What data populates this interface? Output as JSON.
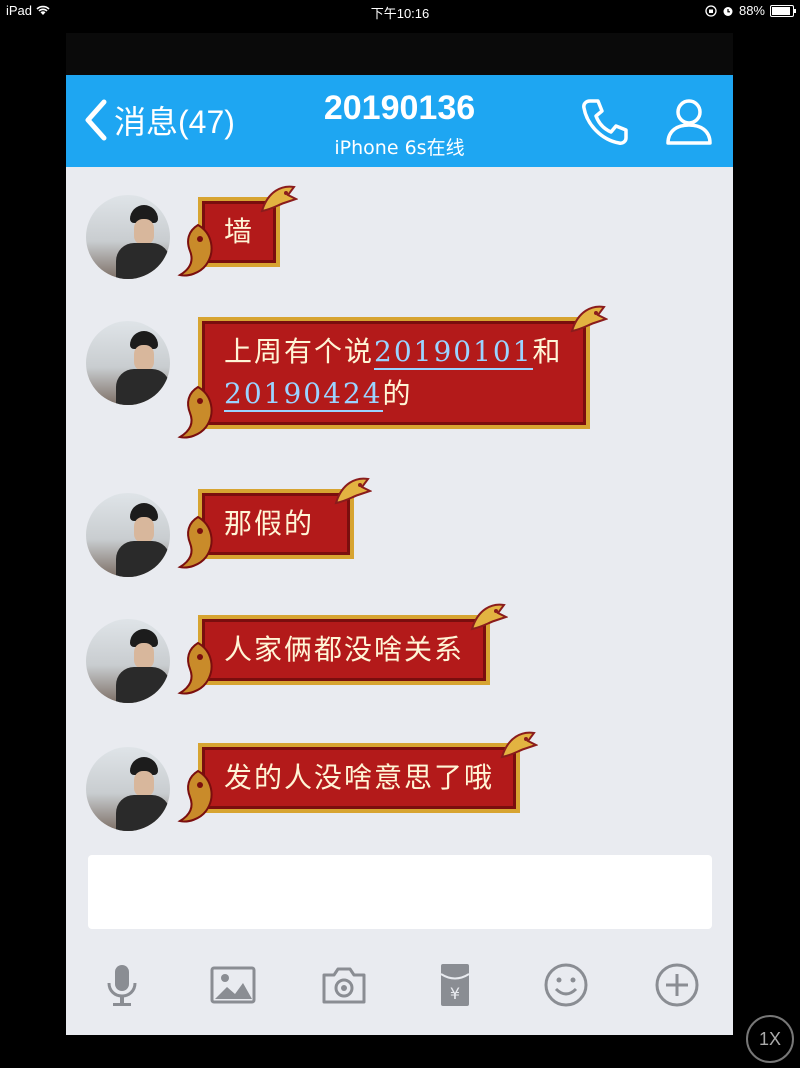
{
  "status_bar": {
    "device": "iPad",
    "time": "下午10:16",
    "battery_text": "88%",
    "battery_level": 0.88
  },
  "navbar": {
    "back_label": "消息(47)",
    "title": "20190136",
    "subtitle": "iPhone 6s在线",
    "accent_color": "#1ea6f2",
    "icons": [
      "chevron-left-icon",
      "phone-icon",
      "person-icon"
    ]
  },
  "messages": [
    {
      "text": "墙"
    },
    {
      "text_before": "上周有个说",
      "link1": "20190101",
      "text_mid": "和",
      "link2": "20190424",
      "text_after": "的"
    },
    {
      "text": "那假的"
    },
    {
      "text": "人家俩都没啥关系"
    },
    {
      "text": "发的人没啥意思了哦"
    }
  ],
  "input": {
    "placeholder": ""
  },
  "toolbar": {
    "icons": [
      "microphone-icon",
      "image-icon",
      "camera-icon",
      "red-packet-icon",
      "emoji-icon",
      "plus-icon"
    ]
  },
  "zoom_badge": "1X",
  "colors": {
    "bubble": "#b31a1a",
    "bubble_border": "#d7a431",
    "background": "#e9ebf0"
  }
}
